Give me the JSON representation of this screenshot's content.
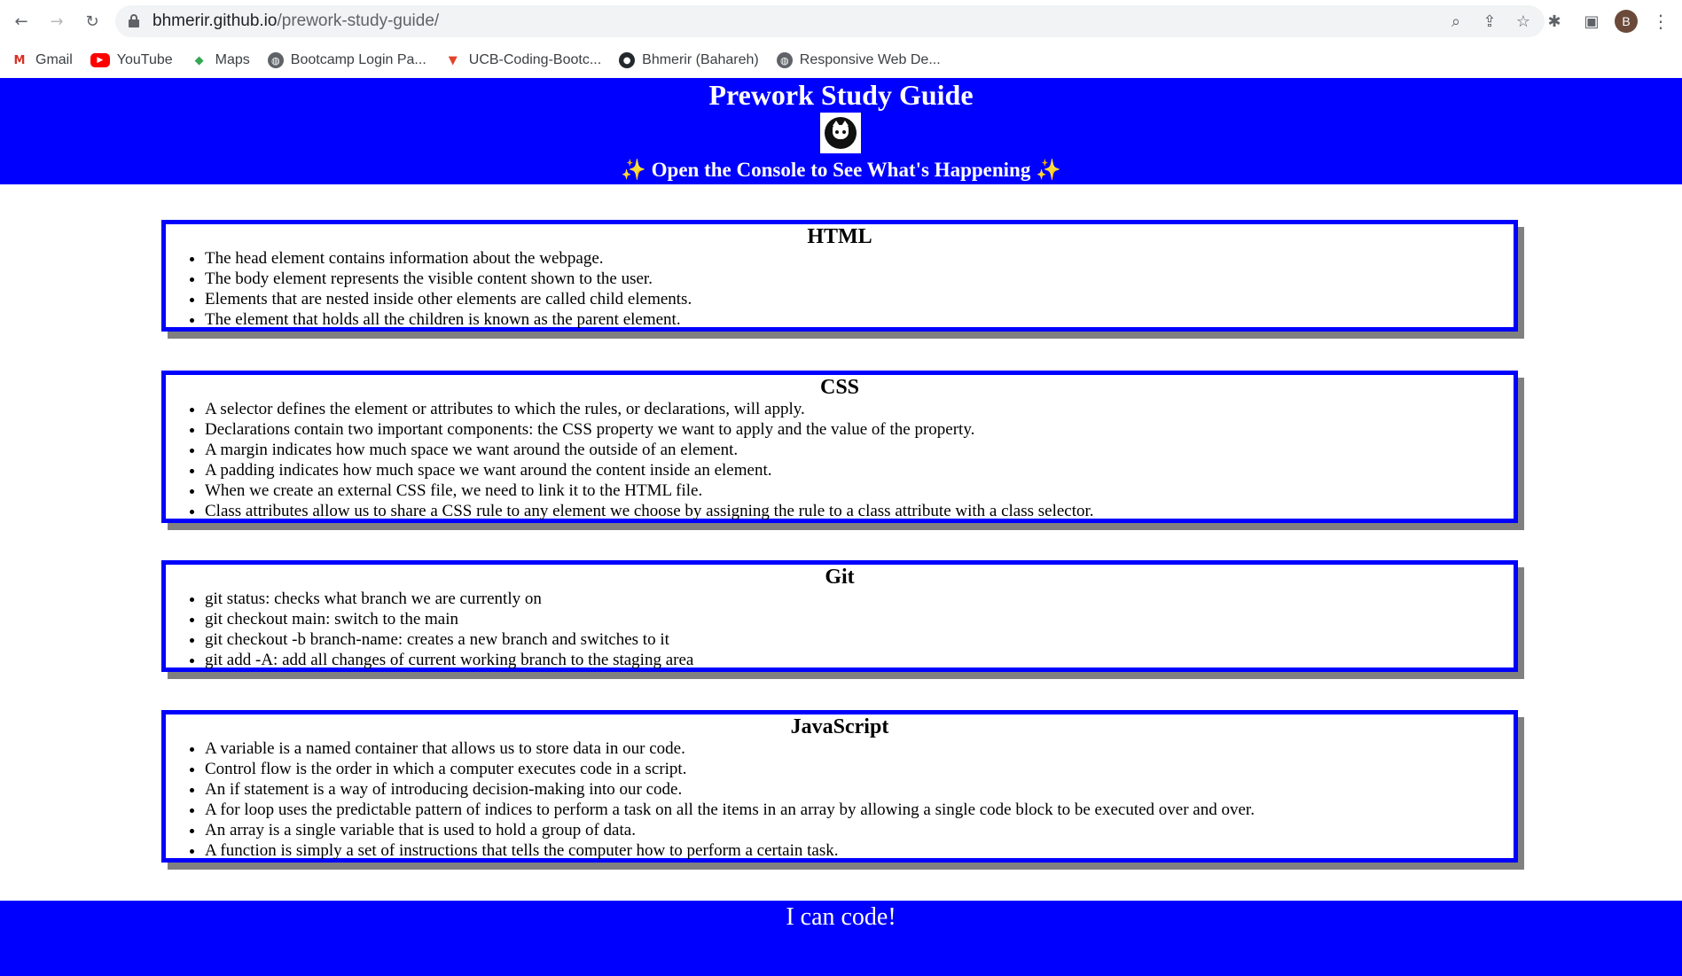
{
  "browser": {
    "url_host": "bhmerir.github.io",
    "url_path": "/prework-study-guide/",
    "profile_initial": "B",
    "bookmarks": [
      {
        "label": "Gmail",
        "icon": "gmail-icon"
      },
      {
        "label": "YouTube",
        "icon": "youtube-icon"
      },
      {
        "label": "Maps",
        "icon": "maps-icon"
      },
      {
        "label": "Bootcamp Login Pa...",
        "icon": "globe-icon"
      },
      {
        "label": "UCB-Coding-Bootc...",
        "icon": "gitlab-icon"
      },
      {
        "label": "Bhmerir (Bahareh)",
        "icon": "github-icon"
      },
      {
        "label": "Responsive Web De...",
        "icon": "globe-icon"
      }
    ]
  },
  "hero": {
    "title": "Prework Study Guide",
    "subtitle": "✨ Open the Console to See What's Happening ✨"
  },
  "sections": [
    {
      "title": "HTML",
      "items": [
        "The head element contains information about the webpage.",
        "The body element represents the visible content shown to the user.",
        "Elements that are nested inside other elements are called child elements.",
        "The element that holds all the children is known as the parent element."
      ]
    },
    {
      "title": "CSS",
      "items": [
        "A selector defines the element or attributes to which the rules, or declarations, will apply.",
        "Declarations contain two important components: the CSS property we want to apply and the value of the property.",
        "A margin indicates how much space we want around the outside of an element.",
        "A padding indicates how much space we want around the content inside an element.",
        "When we create an external CSS file, we need to link it to the HTML file.",
        "Class attributes allow us to share a CSS rule to any element we choose by assigning the rule to a class attribute with a class selector."
      ]
    },
    {
      "title": "Git",
      "items": [
        "git status: checks what branch we are currently on",
        "git checkout main: switch to the main",
        "git checkout -b branch-name: creates a new branch and switches to it",
        "git add -A: add all changes of current working branch to the staging area"
      ]
    },
    {
      "title": "JavaScript",
      "items": [
        "A variable is a named container that allows us to store data in our code.",
        "Control flow is the order in which a computer executes code in a script.",
        "An if statement is a way of introducing decision-making into our code.",
        "A for loop uses the predictable pattern of indices to perform a task on all the items in an array by allowing a single code block to be executed over and over.",
        "An array is a single variable that is used to hold a group of data.",
        "A function is simply a set of instructions that tells the computer how to perform a certain task."
      ]
    }
  ],
  "footer": {
    "text": "I can code!"
  },
  "colors": {
    "primary_blue": "#0000ff",
    "card_shadow": "#808080"
  }
}
